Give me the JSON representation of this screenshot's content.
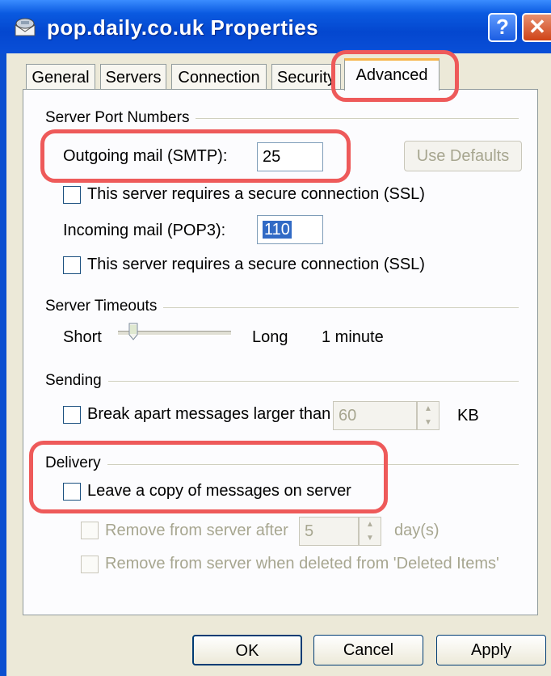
{
  "window": {
    "title": "pop.daily.co.uk Properties",
    "help_glyph": "?",
    "close_glyph": "✕"
  },
  "tabs": [
    {
      "label": "General"
    },
    {
      "label": "Servers"
    },
    {
      "label": "Connection"
    },
    {
      "label": "Security"
    },
    {
      "label": "Advanced"
    }
  ],
  "ports": {
    "group_label": "Server Port Numbers",
    "outgoing_label": "Outgoing mail (SMTP):",
    "outgoing_value": "25",
    "use_defaults": "Use Defaults",
    "outgoing_ssl_label": "This server requires a secure connection (SSL)",
    "incoming_label": "Incoming mail (POP3):",
    "incoming_value": "110",
    "incoming_ssl_label": "This server requires a secure connection (SSL)"
  },
  "timeouts": {
    "group_label": "Server Timeouts",
    "short_label": "Short",
    "long_label": "Long",
    "value_text": "1 minute",
    "slider_level": 0.1
  },
  "sending": {
    "group_label": "Sending",
    "break_label": "Break apart messages larger than",
    "size_value": "60",
    "unit": "KB"
  },
  "delivery": {
    "group_label": "Delivery",
    "leave_copy_label": "Leave a copy of messages on server",
    "remove_after_label": "Remove from server after",
    "days_value": "5",
    "days_unit": "day(s)",
    "remove_deleted_label": "Remove from server when deleted from 'Deleted Items'"
  },
  "buttons": {
    "ok": "OK",
    "cancel": "Cancel",
    "apply": "Apply"
  },
  "colors": {
    "title_bar": "#0a5ae0",
    "dialog_bg": "#ece9d8",
    "highlight": "#ee5a5a",
    "active_tab_accent": "#f7b54b"
  }
}
